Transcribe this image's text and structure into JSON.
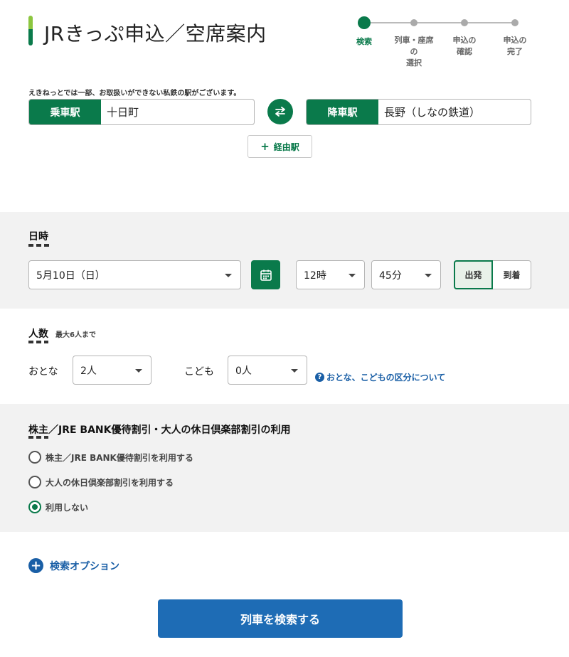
{
  "header": {
    "title": "JRきっぷ申込／空席案内",
    "steps": [
      {
        "label": "検索",
        "active": true
      },
      {
        "label": "列車・座席の\n選択",
        "active": false
      },
      {
        "label": "申込の\n確認",
        "active": false
      },
      {
        "label": "申込の\n完了",
        "active": false
      }
    ]
  },
  "stations": {
    "note": "えきねっとでは一部、お取扱いができない私鉄の駅がございます。",
    "departure_label": "乗車駅",
    "departure_value": "十日町",
    "arrival_label": "降車駅",
    "arrival_value": "長野（しなの鉄道）",
    "via_label": "経由駅"
  },
  "datetime": {
    "title": "日時",
    "date": "5月10日（日）",
    "hour": "12時",
    "minute": "45分",
    "depart_label": "出発",
    "arrive_label": "到着",
    "selected": "出発"
  },
  "people": {
    "title": "人数",
    "note": "最大6人まで",
    "adult_label": "おとな",
    "adult_value": "2人",
    "child_label": "こども",
    "child_value": "0人",
    "help_link": "おとな、こどもの区分について"
  },
  "discount": {
    "title": "株主／JRE BANK優待割引・大人の休日倶楽部割引の利用",
    "options": [
      {
        "label": "株主／JRE BANK優待割引を利用する",
        "checked": false
      },
      {
        "label": "大人の休日倶楽部割引を利用する",
        "checked": false
      },
      {
        "label": "利用しない",
        "checked": true
      }
    ]
  },
  "search_options_label": "検索オプション",
  "search_button_label": "列車を検索する",
  "colors": {
    "brand_green": "#0a7a4b",
    "link_blue": "#1a5fa6",
    "button_blue": "#1e6cb5"
  }
}
